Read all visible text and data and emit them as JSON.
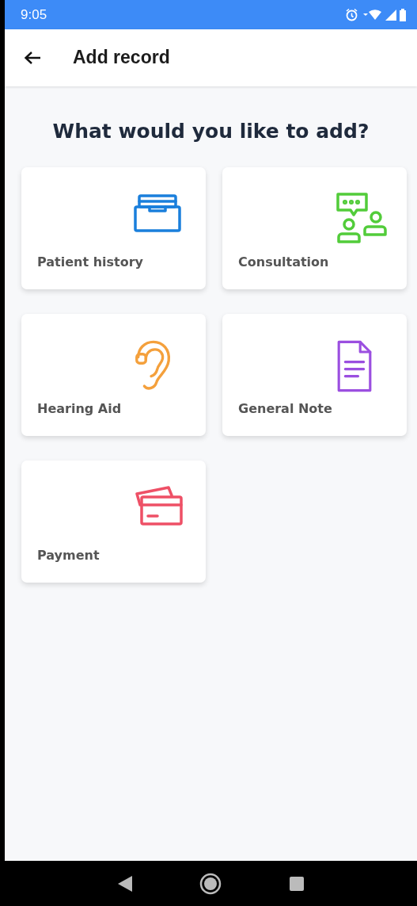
{
  "status_bar": {
    "time": "9:05"
  },
  "app_bar": {
    "title": "Add record"
  },
  "heading": "What would you like to add?",
  "options": [
    {
      "label": "Patient history",
      "kind": "archive",
      "color": "#1a7fdc"
    },
    {
      "label": "Consultation",
      "kind": "consult",
      "color": "#52cc3a"
    },
    {
      "label": "Hearing Aid",
      "kind": "ear",
      "color": "#f4a03c"
    },
    {
      "label": "General Note",
      "kind": "note",
      "color": "#9b4fe0"
    },
    {
      "label": "Payment",
      "kind": "card",
      "color": "#ee5066"
    }
  ]
}
